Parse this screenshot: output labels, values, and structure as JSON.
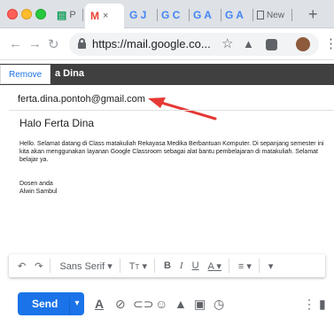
{
  "browser": {
    "tabs": [
      {
        "icon": "gmail-icon",
        "label": "P"
      },
      {
        "icon": "gmail-icon",
        "label": "M"
      },
      {
        "icon": "google-icon",
        "label": "G J"
      },
      {
        "icon": "google-icon",
        "label": "G C"
      },
      {
        "icon": "google-icon",
        "label": "G A"
      },
      {
        "icon": "google-icon",
        "label": "G A"
      },
      {
        "icon": "page-icon",
        "label": "New"
      }
    ],
    "active_tab_close": "×",
    "url": "https://mail.google.co...",
    "colors": {
      "accent": "#1a73e8",
      "arrow": "#e53935"
    }
  },
  "compose": {
    "remove_label": "Remove",
    "header_title": "a Dina",
    "to": "ferta.dina.pontoh@gmail.com",
    "subject": "Halo Ferta Dina",
    "body": "Hello. Selamat datang di Class matakuliah Rekayasa Medika Berbantuan Komputer. Di sepanjang semester ini kita akan menggunakan layanan Google Classroom sebagai alat bantu pembelajaran di matakuliah. Selamat belajar ya.",
    "signature_line1": "Dosen anda",
    "signature_line2": "Alwin Sambul"
  },
  "format_bar": {
    "font_family": "Sans Serif",
    "bold": "B",
    "italic": "I",
    "underline": "U",
    "text_color": "A"
  },
  "send_bar": {
    "send_label": "Send"
  }
}
